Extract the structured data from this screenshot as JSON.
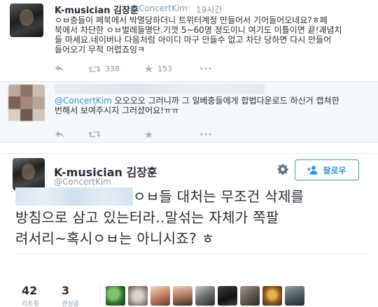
{
  "tweet1": {
    "name": "K-musician 김장훈",
    "handle": "@ConcertKim",
    "dot": "·",
    "time": "19시간",
    "lines": [
      "ㅇㅂ충들이 페북에서 박멸당하더니 트위터계정 만들어서 기어들어오네요?ㅎ페",
      "북에서 차단한 ㅇㅂ벌레들명단.기껏 5~60명 정도이니 여기도 이틀이면 끝!괘념치",
      "들 마세요.네이버나 다음처럼 아이디 마구 만들수 없고 차단 당하면 다시 만들어",
      "들어오기 무척 어렵죠잉ㅋ"
    ],
    "retweets": "338",
    "likes": "153"
  },
  "tweet2": {
    "mention": "@ConcertKim",
    "text_line1": " 오오오오 그러니까 그 일베충들에게 합법다운로드 하신거 캡쳐한",
    "text_line2": "번해서 보여주시지 그러셨어요!ㅠㅠ"
  },
  "tweet3": {
    "name": "K-musician 김장훈",
    "handle": "@ConcertKim",
    "follow_label": "팔로우",
    "line1": "ㅇㅂ들 대처는 무조건 삭제를",
    "line2": "방침으로 삼고 있는터라..말섞는 자체가 쪽팔",
    "line3": "려서리~혹시ㅇㅂ는 아니시죠? ㅎ",
    "retweet_count": "42",
    "retweet_label": "리트윗",
    "like_count": "3",
    "like_label": "관심글"
  },
  "colors": {
    "accent": "#3b94d9",
    "muted": "#8899a6",
    "text": "#292f33",
    "border": "#e1e8ed"
  },
  "icons": [
    "reply-icon",
    "retweet-icon",
    "star-icon",
    "more-icon",
    "gear-icon",
    "add-user-icon"
  ]
}
